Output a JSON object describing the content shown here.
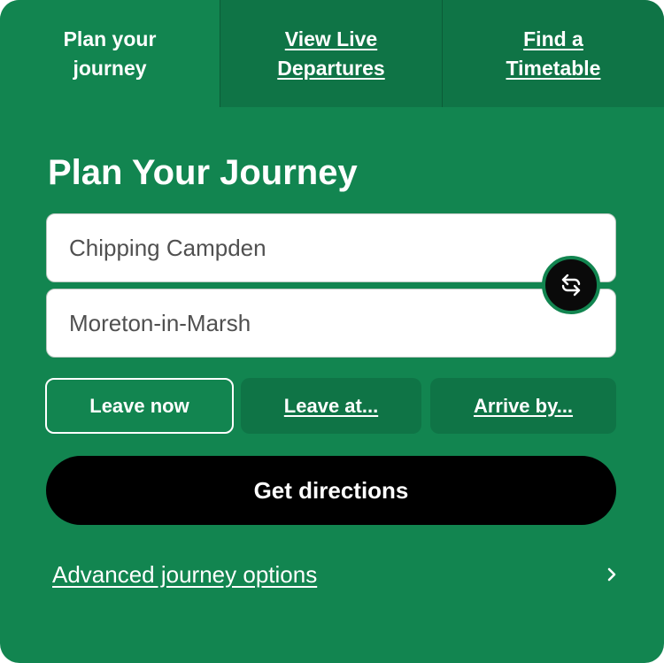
{
  "tabs": [
    {
      "label": "Plan your journey",
      "active": true
    },
    {
      "label": "View Live Departures",
      "active": false
    },
    {
      "label": "Find a Timetable",
      "active": false
    }
  ],
  "heading": "Plan Your Journey",
  "from": {
    "value": "Chipping Campden"
  },
  "to": {
    "value": "Moreton-in-Marsh"
  },
  "swap": {
    "icon": "swap-arrows-icon"
  },
  "time_options": {
    "now": "Leave now",
    "at": "Leave at...",
    "by": "Arrive by...",
    "selected": "now"
  },
  "get_directions": "Get directions",
  "advanced": {
    "label": "Advanced journey options",
    "icon": "chevron-right-icon"
  },
  "colors": {
    "panel": "#128550",
    "inactive_tab": "#0f7446",
    "button": "#000000",
    "text": "#ffffff"
  }
}
